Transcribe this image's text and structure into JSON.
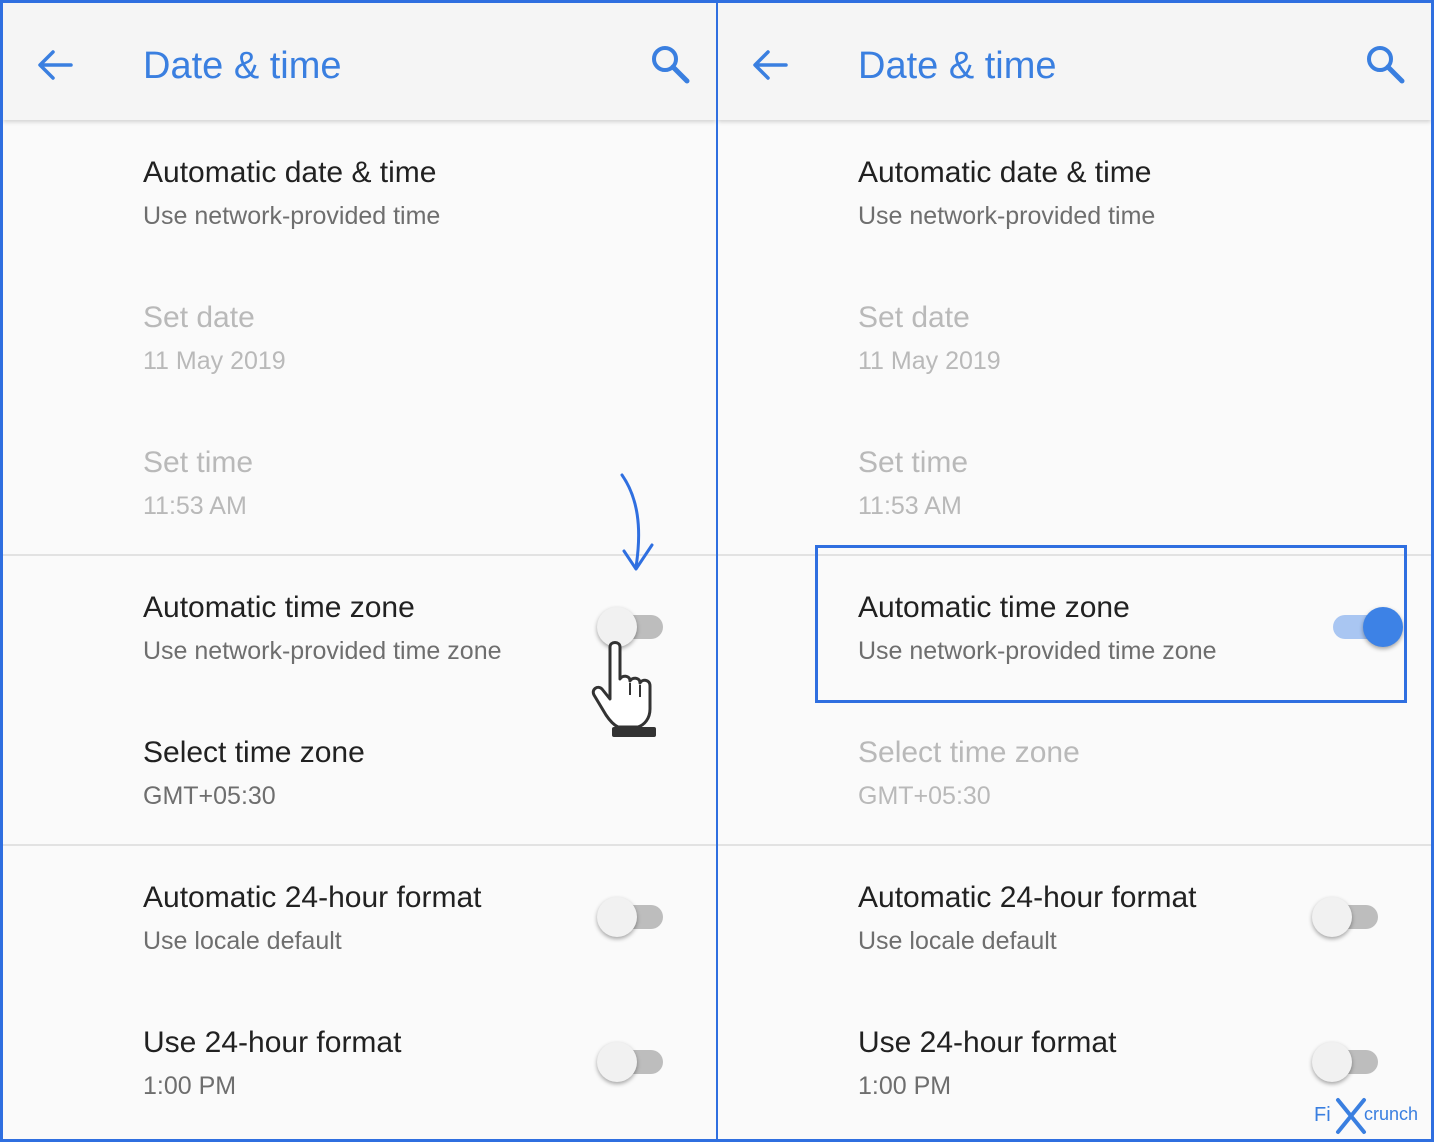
{
  "colors": {
    "accent": "#3a7fe0",
    "annotation": "#2f6fe0",
    "switch_on": "#3d82e6",
    "text_primary": "#212121",
    "text_secondary": "#6e6e6e",
    "text_disabled": "#b9b9b9"
  },
  "icons": {
    "back": "arrow-left-icon",
    "search": "search-icon"
  },
  "left_panel": {
    "title": "Date & time",
    "settings": [
      {
        "title": "Automatic date & time",
        "subtitle": "Use network-provided time"
      },
      {
        "title": "Set date",
        "subtitle": "11 May 2019",
        "disabled": true
      },
      {
        "title": "Set time",
        "subtitle": "11:53 AM",
        "disabled": true
      },
      {
        "title": "Automatic time zone",
        "subtitle": "Use network-provided time zone",
        "toggle": false
      },
      {
        "title": "Select time zone",
        "subtitle": "GMT+05:30"
      },
      {
        "title": "Automatic 24-hour format",
        "subtitle": "Use locale default",
        "toggle": false
      },
      {
        "title": "Use 24-hour format",
        "subtitle": "1:00 PM",
        "toggle": false
      }
    ]
  },
  "right_panel": {
    "title": "Date & time",
    "settings": [
      {
        "title": "Automatic date & time",
        "subtitle": "Use network-provided time"
      },
      {
        "title": "Set date",
        "subtitle": "11 May 2019",
        "disabled": true
      },
      {
        "title": "Set time",
        "subtitle": "11:53 AM",
        "disabled": true
      },
      {
        "title": "Automatic time zone",
        "subtitle": "Use network-provided time zone",
        "toggle": true
      },
      {
        "title": "Select time zone",
        "subtitle": "GMT+05:30",
        "disabled": true
      },
      {
        "title": "Automatic 24-hour format",
        "subtitle": "Use locale default",
        "toggle": false
      },
      {
        "title": "Use 24-hour format",
        "subtitle": "1:00 PM",
        "toggle": false
      }
    ]
  },
  "watermark": {
    "left": "Fi",
    "right": "crunch"
  }
}
